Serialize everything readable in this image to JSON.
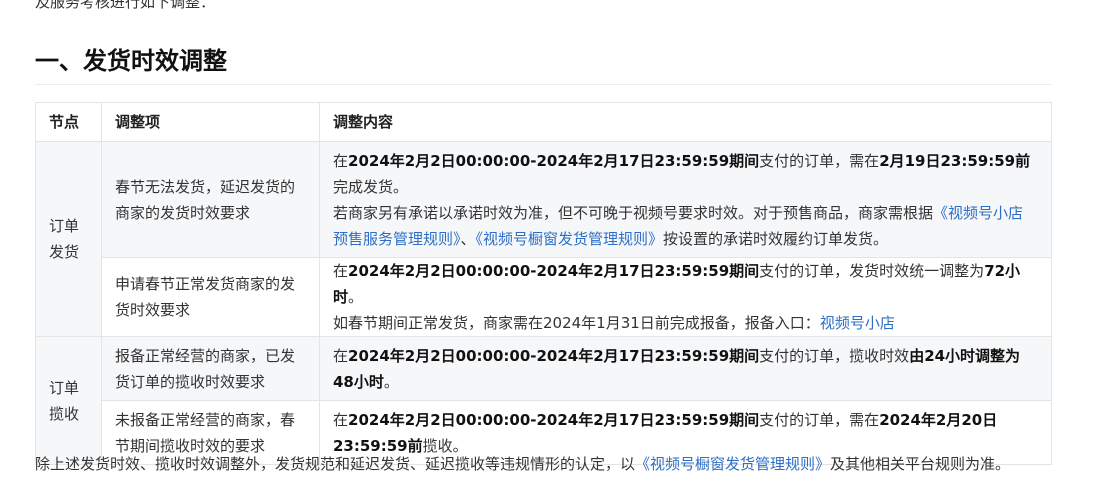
{
  "intro_text": "及服务考核进行如下调整：",
  "section_title": "一、发货时效调整",
  "table": {
    "headers": [
      "节点",
      "调整项",
      "调整内容"
    ],
    "groups": [
      {
        "node": "订单发货",
        "rows": [
          {
            "item": "春节无法发货，延迟发货的商家的发货时效要求",
            "paragraphs": [
              [
                {
                  "t": "在"
                },
                {
                  "t": "2024年2月2日00:00:00-2024年2月17日23:59:59期间",
                  "bold": true
                },
                {
                  "t": "支付的订单，需在"
                },
                {
                  "t": "2月19日23:59:59前",
                  "bold": true
                },
                {
                  "t": "完成发货。"
                }
              ],
              [
                {
                  "t": "若商家另有承诺以承诺时效为准，但不可晚于视频号要求时效。对于预售商品，商家需根据"
                },
                {
                  "t": "《视频号小店预售服务管理规则》",
                  "link": true
                },
                {
                  "t": "、"
                },
                {
                  "t": "《视频号橱窗发货管理规则》",
                  "link": true
                },
                {
                  "t": "按设置的承诺时效履约订单发货。"
                }
              ]
            ]
          },
          {
            "item": "申请春节正常发货商家的发货时效要求",
            "paragraphs": [
              [
                {
                  "t": "在"
                },
                {
                  "t": "2024年2月2日00:00:00-2024年2月17日23:59:59期间",
                  "bold": true
                },
                {
                  "t": "支付的订单，发货时效统一调整为"
                },
                {
                  "t": "72小时",
                  "bold": true
                },
                {
                  "t": "。"
                }
              ],
              [
                {
                  "t": "如春节期间正常发货，商家需在2024年1月31日前完成报备，报备入口："
                },
                {
                  "t": "视频号小店",
                  "link": true
                }
              ]
            ]
          }
        ]
      },
      {
        "node": "订单揽收",
        "rows": [
          {
            "item": "报备正常经营的商家，已发货订单的揽收时效要求",
            "paragraphs": [
              [
                {
                  "t": "在"
                },
                {
                  "t": "2024年2月2日00:00:00-2024年2月17日23:59:59期间",
                  "bold": true
                },
                {
                  "t": "支付的订单，揽收时效"
                },
                {
                  "t": "由24小时调整为48小时",
                  "bold": true
                },
                {
                  "t": "。"
                }
              ]
            ]
          },
          {
            "item": "未报备正常经营的商家，春节期间揽收时效的要求",
            "paragraphs": [
              [
                {
                  "t": "在"
                },
                {
                  "t": "2024年2月2日00:00:00-2024年2月17日23:59:59期间",
                  "bold": true
                },
                {
                  "t": "支付的订单，需在"
                },
                {
                  "t": "2024年2月20日23:59:59前",
                  "bold": true
                },
                {
                  "t": "揽收。"
                }
              ]
            ]
          }
        ]
      }
    ]
  },
  "footer": [
    {
      "t": "除上述发货时效、揽收时效调整外，发货规范和延迟发货、延迟揽收等违规情形的认定，以"
    },
    {
      "t": "《视频号橱窗发货管理规则》",
      "link": true
    },
    {
      "t": "及其他相关平台规则为准。"
    }
  ],
  "colors": {
    "link": "#2d6fc6",
    "row_alt_bg": "#f6f7f9",
    "border": "#e4e4e4"
  }
}
